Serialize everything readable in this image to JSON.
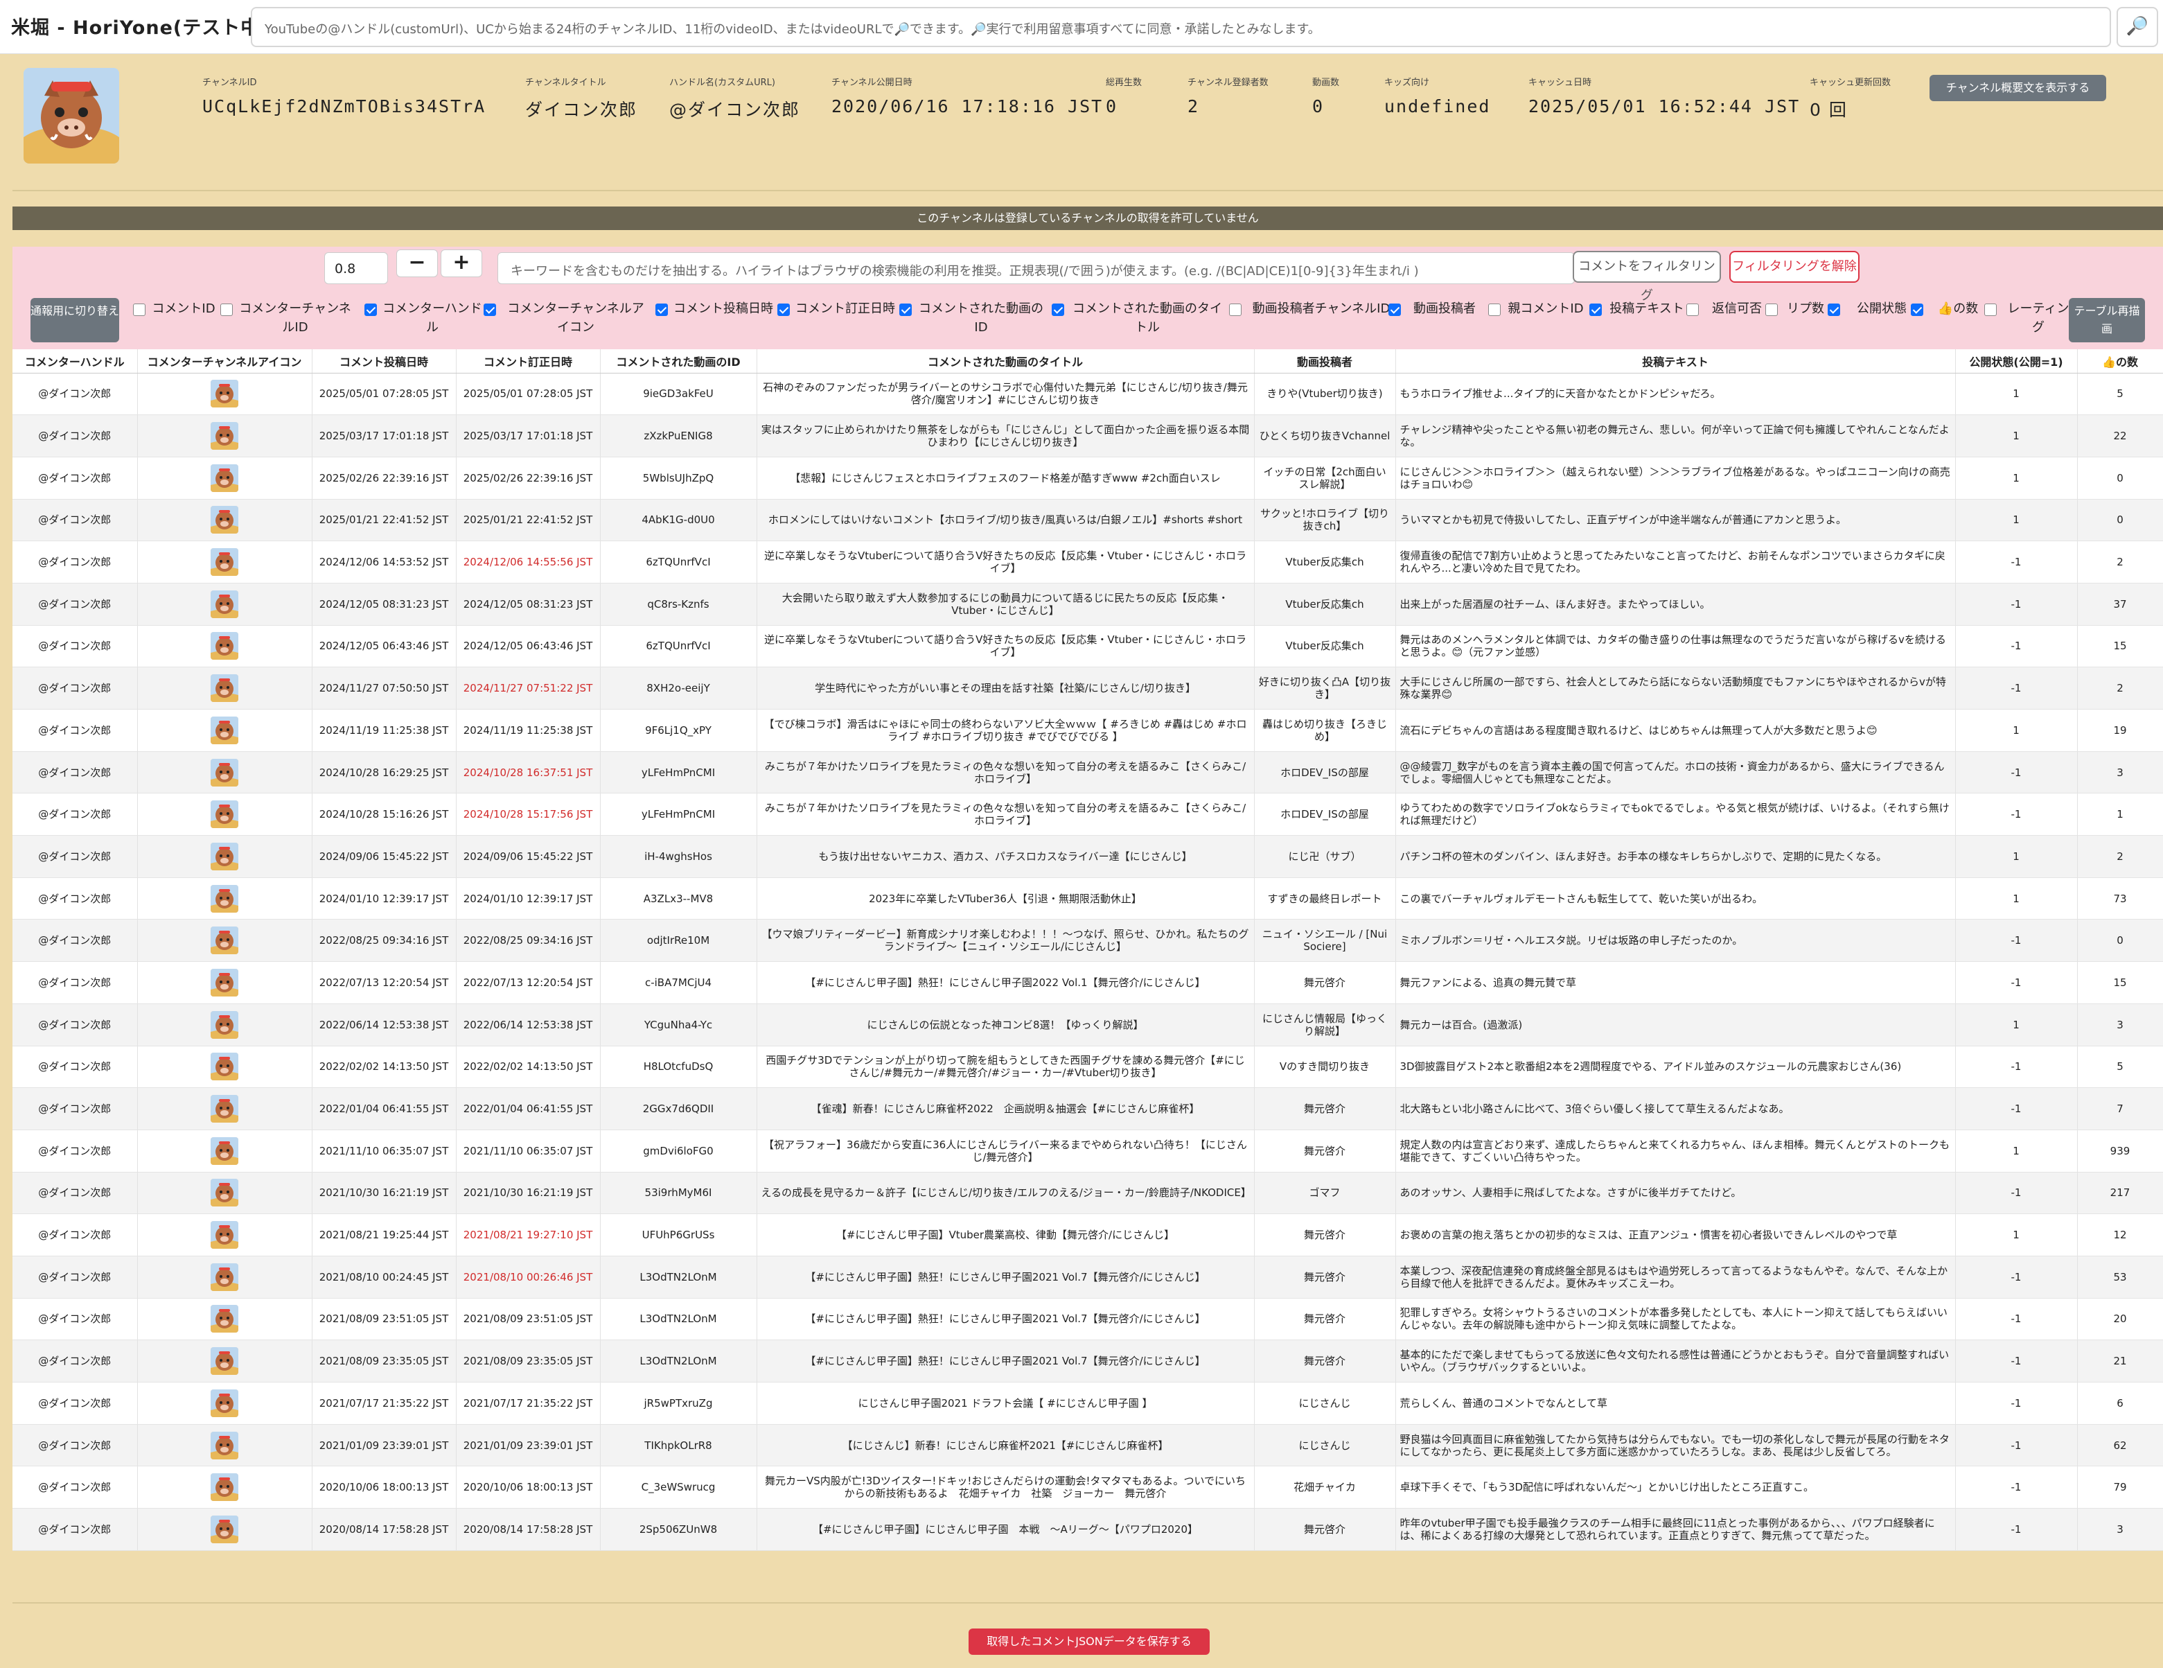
{
  "app": {
    "title": "米堀 - HoriYone(テスト中)",
    "search_placeholder": "YouTubeの@ハンドル(customUrl)、UCから始まる24桁のチャンネルID、11桁のvideoID、またはvideoURLで🔎できます。🔎実行で利用留意事項すべてに同意・承諾したとみなします。",
    "search_button_icon": "🔎"
  },
  "channel": {
    "fields": [
      {
        "label": "チャンネルID",
        "value": "UCqLkEjf2dNZmTOBis34STrA"
      },
      {
        "label": "チャンネルタイトル",
        "value": "ダイコン次郎"
      },
      {
        "label": "ハンドル名(カスタムURL)",
        "value": "@ダイコン次郎"
      },
      {
        "label": "チャンネル公開日時",
        "value": "2020/06/16 17:18:16 JST"
      },
      {
        "label": "総再生数",
        "value": "0"
      },
      {
        "label": "チャンネル登録者数",
        "value": "2"
      },
      {
        "label": "動画数",
        "value": "0"
      },
      {
        "label": "キッズ向け",
        "value": "undefined"
      },
      {
        "label": "キャッシュ日時",
        "value": "2025/05/01 16:52:44 JST"
      },
      {
        "label": "キャッシュ更新回数",
        "value": "0 回"
      }
    ],
    "show_description_button": "チャンネル概要文を表示する"
  },
  "notice": "このチャンネルは登録しているチャンネルの取得を許可していません",
  "filter": {
    "threshold_value": "0.8",
    "minus_label": "−",
    "plus_label": "+",
    "keyword_placeholder": "キーワードを含むものだけを抽出する。ハイライトはブラウザの検索機能の利用を推奨。正規表現(/で囲う)が使えます。(e.g. /(BC|AD|CE)1[0-9]{3}年生まれ/i )",
    "filter_button": "コメントをフィルタリング",
    "clear_button": "フィルタリングを解除",
    "mode_button": "通報用に切り替え",
    "redraw_button": "テーブル再描画",
    "columns": [
      {
        "label": "コメントID",
        "checked": false
      },
      {
        "label": "コメンターチャンネルID",
        "checked": false
      },
      {
        "label": "コメンターハンドル",
        "checked": true
      },
      {
        "label": "コメンターチャンネルアイコン",
        "checked": true
      },
      {
        "label": "コメント投稿日時",
        "checked": true
      },
      {
        "label": "コメント訂正日時",
        "checked": true
      },
      {
        "label": "コメントされた動画のID",
        "checked": true
      },
      {
        "label": "コメントされた動画のタイトル",
        "checked": true
      },
      {
        "label": "動画投稿者チャンネルID",
        "checked": false
      },
      {
        "label": "動画投稿者",
        "checked": true
      },
      {
        "label": "親コメントID",
        "checked": false
      },
      {
        "label": "投稿テキスト",
        "checked": true
      },
      {
        "label": "返信可否",
        "checked": false
      },
      {
        "label": "リプ数",
        "checked": false
      },
      {
        "label": "公開状態",
        "checked": true
      },
      {
        "label": "👍の数",
        "checked": true
      },
      {
        "label": "レーティング",
        "checked": false
      }
    ]
  },
  "table": {
    "headers": [
      "コメンターハンドル",
      "コメンターチャンネルアイコン",
      "コメント投稿日時",
      "コメント訂正日時",
      "コメントされた動画のID",
      "コメントされた動画のタイトル",
      "動画投稿者",
      "投稿テキスト",
      "公開状態(公開=1)",
      "👍の数"
    ],
    "rows": [
      {
        "handle": "@ダイコン次郎",
        "posted": "2025/05/01 07:28:05 JST",
        "edited": "2025/05/01 07:28:05 JST",
        "edited_red": false,
        "video_id": "9ieGD3akFeU",
        "video_title": "石神のぞみのファンだったが男ライバーとのサシコラボで心傷付いた舞元弟【にじさんじ/切り抜き/舞元啓介/魔宮リオン】#にじさんじ切り抜き",
        "uploader": "きりや(Vtuber切り抜き)",
        "text": "もうホロライブ推せよ...タイプ的に天音かなたとかドンピシャだろ。",
        "public": "1",
        "likes": "5"
      },
      {
        "handle": "@ダイコン次郎",
        "posted": "2025/03/17 17:01:18 JST",
        "edited": "2025/03/17 17:01:18 JST",
        "edited_red": false,
        "video_id": "zXzkPuENIG8",
        "video_title": "実はスタッフに止められかけたり無茶をしながらも「にじさんじ」として面白かった企画を振り返る本間ひまわり【にじさんじ切り抜き】",
        "uploader": "ひとくち切り抜きVchannel",
        "text": "チャレンジ精神や尖ったことやる無い初老の舞元さん、悲しい。何が辛いって正論で何も擁護してやれんことなんだよな。",
        "public": "1",
        "likes": "22"
      },
      {
        "handle": "@ダイコン次郎",
        "posted": "2025/02/26 22:39:16 JST",
        "edited": "2025/02/26 22:39:16 JST",
        "edited_red": false,
        "video_id": "5WblsUJhZpQ",
        "video_title": "【悲報】にじさんじフェスとホロライブフェスのフード格差が酷すぎwww #2ch面白いスレ",
        "uploader": "イッチの日常【2ch面白いスレ解説】",
        "text": "にじさんじ＞＞＞ホロライブ＞＞（越えられない壁）＞＞＞ラブライブ位格差があるな。やっぱユニコーン向けの商売はチョロいわ😊",
        "public": "1",
        "likes": "0"
      },
      {
        "handle": "@ダイコン次郎",
        "posted": "2025/01/21 22:41:52 JST",
        "edited": "2025/01/21 22:41:52 JST",
        "edited_red": false,
        "video_id": "4AbK1G-d0U0",
        "video_title": "ホロメンにしてはいけないコメント【ホロライブ/切り抜き/風真いろは/白銀ノエル】#shorts #short",
        "uploader": "サクッと!ホロライブ【切り抜きch】",
        "text": "ういママとかも初見で侍扱いしてたし、正直デザインが中途半端なんが普通にアカンと思うよ。",
        "public": "1",
        "likes": "0"
      },
      {
        "handle": "@ダイコン次郎",
        "posted": "2024/12/06 14:53:52 JST",
        "edited": "2024/12/06 14:55:56 JST",
        "edited_red": true,
        "video_id": "6zTQUnrfVcI",
        "video_title": "逆に卒業しなそうなVtuberについて語り合うV好きたちの反応【反応集・Vtuber・にじさんじ・ホロライブ】",
        "uploader": "Vtuber反応集ch",
        "text": "復帰直後の配信で7割方い止めようと思ってたみたいなこと言ってたけど、お前そんなポンコツでいまさらカタギに戻れんやろ...と凄い冷めた目で見てたわ。",
        "public": "-1",
        "likes": "2"
      },
      {
        "handle": "@ダイコン次郎",
        "posted": "2024/12/05 08:31:23 JST",
        "edited": "2024/12/05 08:31:23 JST",
        "edited_red": false,
        "video_id": "qC8rs-Kznfs",
        "video_title": "大会開いたら取り敢えず大人数参加するにじの動員力について語るじに民たちの反応【反応集・Vtuber・にじさんじ】",
        "uploader": "Vtuber反応集ch",
        "text": "出来上がった居酒屋の社チーム、ほんま好き。またやってほしい。",
        "public": "-1",
        "likes": "37"
      },
      {
        "handle": "@ダイコン次郎",
        "posted": "2024/12/05 06:43:46 JST",
        "edited": "2024/12/05 06:43:46 JST",
        "edited_red": false,
        "video_id": "6zTQUnrfVcI",
        "video_title": "逆に卒業しなそうなVtuberについて語り合うV好きたちの反応【反応集・Vtuber・にじさんじ・ホロライブ】",
        "uploader": "Vtuber反応集ch",
        "text": "舞元はあのメンヘラメンタルと体調では、カタギの働き盛りの仕事は無理なのでうだうだ言いながら稼げるvを続けると思うよ。😊（元ファン並感）",
        "public": "-1",
        "likes": "15"
      },
      {
        "handle": "@ダイコン次郎",
        "posted": "2024/11/27 07:50:50 JST",
        "edited": "2024/11/27 07:51:22 JST",
        "edited_red": true,
        "video_id": "8XH2o-eeijY",
        "video_title": "学生時代にやった方がいい事とその理由を話す社築【社築/にじさんじ/切り抜き】",
        "uploader": "好きに切り抜く凸A【切り抜き】",
        "text": "大手にじさんじ所属の一部ですら、社会人としてみたら話にならない活動頻度でもファンにちやほやされるからvが特殊な業界😊",
        "public": "-1",
        "likes": "2"
      },
      {
        "handle": "@ダイコン次郎",
        "posted": "2024/11/19 11:25:38 JST",
        "edited": "2024/11/19 11:25:38 JST",
        "edited_red": false,
        "video_id": "9F6Lj1Q_xPY",
        "video_title": "【でび棟コラボ】滑舌はにゃほにゃ同士の終わらないアソビ大全ｗｗｗ【 #ろきじめ #轟はじめ #ホロライブ #ホロライブ切り抜き #でびでびでびる 】",
        "uploader": "轟はじめ切り抜き【ろきじめ】",
        "text": "流石にデビちゃんの言語はある程度聞き取れるけど、はじめちゃんは無理って人が大多数だと思うよ😊",
        "public": "1",
        "likes": "19"
      },
      {
        "handle": "@ダイコン次郎",
        "posted": "2024/10/28 16:29:25 JST",
        "edited": "2024/10/28 16:37:51 JST",
        "edited_red": true,
        "video_id": "yLFeHmPnCMI",
        "video_title": "みこちが７年かけたソロライブを見たラミィの色々な想いを知って自分の考えを語るみこ【さくらみこ/ホロライブ】",
        "uploader": "ホロDEV_ISの部屋",
        "text": "@@綾雲刀_数字がものを言う資本主義の国で何言ってんだ。ホロの技術・資金力があるから、盛大にライブできるんでしょ。零細個人じゃとても無理なことだよ。",
        "public": "-1",
        "likes": "3"
      },
      {
        "handle": "@ダイコン次郎",
        "posted": "2024/10/28 15:16:26 JST",
        "edited": "2024/10/28 15:17:56 JST",
        "edited_red": true,
        "video_id": "yLFeHmPnCMI",
        "video_title": "みこちが７年かけたソロライブを見たラミィの色々な想いを知って自分の考えを語るみこ【さくらみこ/ホロライブ】",
        "uploader": "ホロDEV_ISの部屋",
        "text": "ゆうてわための数字でソロライブokならラミィでもokでるでしょ。やる気と根気が続けば、いけるよ。（それすら無ければ無理だけど）",
        "public": "-1",
        "likes": "1"
      },
      {
        "handle": "@ダイコン次郎",
        "posted": "2024/09/06 15:45:22 JST",
        "edited": "2024/09/06 15:45:22 JST",
        "edited_red": false,
        "video_id": "iH-4wghsHos",
        "video_title": "もう抜け出せないヤニカス、酒カス、パチスロカスなライバー達【にじさんじ】",
        "uploader": "にじ卍（サブ）",
        "text": "パチンコ杯の笹木のダンバイン、ほんま好き。お手本の様なキレちらかしぶりで、定期的に見たくなる。",
        "public": "1",
        "likes": "2"
      },
      {
        "handle": "@ダイコン次郎",
        "posted": "2024/01/10 12:39:17 JST",
        "edited": "2024/01/10 12:39:17 JST",
        "edited_red": false,
        "video_id": "A3ZLx3--MV8",
        "video_title": "2023年に卒業したVTuber36人【引退・無期限活動休止】",
        "uploader": "すずきの最終日レポート",
        "text": "この裏でバーチャルヴォルデモートさんも転生してて、乾いた笑いが出るわ。",
        "public": "1",
        "likes": "73"
      },
      {
        "handle": "@ダイコン次郎",
        "posted": "2022/08/25 09:34:16 JST",
        "edited": "2022/08/25 09:34:16 JST",
        "edited_red": false,
        "video_id": "odjtIrRe10M",
        "video_title": "【ウマ娘プリティーダービー】新育成シナリオ楽しむわよ！！！〜つなげ、照らせ、ひかれ。私たちのグランドライブ〜【ニュイ・ソシエール/にじさんじ】",
        "uploader": "ニュイ・ソシエール / [Nui Sociere]",
        "text": "ミホノブルボン＝リゼ・ヘルエスタ説。リゼは坂路の申し子だったのか。",
        "public": "-1",
        "likes": "0"
      },
      {
        "handle": "@ダイコン次郎",
        "posted": "2022/07/13 12:20:54 JST",
        "edited": "2022/07/13 12:20:54 JST",
        "edited_red": false,
        "video_id": "c-iBA7MCjU4",
        "video_title": "【#にじさんじ甲子園】熱狂！にじさんじ甲子園2022 Vol.1【舞元啓介/にじさんじ】",
        "uploader": "舞元啓介",
        "text": "舞元ファンによる、追真の舞元賛で草",
        "public": "-1",
        "likes": "15"
      },
      {
        "handle": "@ダイコン次郎",
        "posted": "2022/06/14 12:53:38 JST",
        "edited": "2022/06/14 12:53:38 JST",
        "edited_red": false,
        "video_id": "YCguNha4-Yc",
        "video_title": "にじさんじの伝説となった神コンビ8選！【ゆっくり解説】",
        "uploader": "にじさんじ情報局【ゆっくり解説】",
        "text": "舞元カーは百合。(過激派)",
        "public": "1",
        "likes": "3"
      },
      {
        "handle": "@ダイコン次郎",
        "posted": "2022/02/02 14:13:50 JST",
        "edited": "2022/02/02 14:13:50 JST",
        "edited_red": false,
        "video_id": "H8LOtcfuDsQ",
        "video_title": "西園チグサ3Dでテンションが上がり切って腕を組もうとしてきた西園チグサを諌める舞元啓介【#にじさんじ/#舞元カー/#舞元啓介/#ジョー・カー/#Vtuber切り抜き】",
        "uploader": "Vのすき間切り抜き",
        "text": "3D御披露目ゲスト2本と歌番組2本を2週間程度でやる、アイドル並みのスケジュールの元農家おじさん(36)",
        "public": "-1",
        "likes": "5"
      },
      {
        "handle": "@ダイコン次郎",
        "posted": "2022/01/04 06:41:55 JST",
        "edited": "2022/01/04 06:41:55 JST",
        "edited_red": false,
        "video_id": "2GGx7d6QDII",
        "video_title": "【雀魂】新春！にじさんじ麻雀杯2022　企画説明＆抽選会【#にじさんじ麻雀杯】",
        "uploader": "舞元啓介",
        "text": "北大路もとい北小路さんに比べて、3倍ぐらい優しく接してて草生えるんだよなあ。",
        "public": "-1",
        "likes": "7"
      },
      {
        "handle": "@ダイコン次郎",
        "posted": "2021/11/10 06:35:07 JST",
        "edited": "2021/11/10 06:35:07 JST",
        "edited_red": false,
        "video_id": "gmDvi6loFG0",
        "video_title": "【祝アラフォー】36歳だから安直に36人にじさんじライバー来るまでやめられない凸待ち！【にじさんじ/舞元啓介】",
        "uploader": "舞元啓介",
        "text": "規定人数の内は宣言どおり来ず、達成したらちゃんと来てくれる力ちゃん、ほんま相棒。舞元くんとゲストのトークも堪能できて、すごくいい凸待ちやった。",
        "public": "1",
        "likes": "939"
      },
      {
        "handle": "@ダイコン次郎",
        "posted": "2021/10/30 16:21:19 JST",
        "edited": "2021/10/30 16:21:19 JST",
        "edited_red": false,
        "video_id": "53i9rhMyM6I",
        "video_title": "えるの成長を見守るカー＆許子【にじさんじ/切り抜き/エルフのえる/ジョー・カー/鈴鹿詩子/NKODICE】",
        "uploader": "ゴマフ",
        "text": "あのオッサン、人妻相手に飛ばしてたよな。さすがに後半ガチてたけど。",
        "public": "-1",
        "likes": "217"
      },
      {
        "handle": "@ダイコン次郎",
        "posted": "2021/08/21 19:25:44 JST",
        "edited": "2021/08/21 19:27:10 JST",
        "edited_red": true,
        "video_id": "UFUhP6GrUSs",
        "video_title": "【#にじさんじ甲子園】Vtuber農業高校、律動【舞元啓介/にじさんじ】",
        "uploader": "舞元啓介",
        "text": "お褒めの言葉の抱え落ちとかの初歩的なミスは、正直アンジュ・慣害を初心者扱いできんレベルのやつで草",
        "public": "1",
        "likes": "12"
      },
      {
        "handle": "@ダイコン次郎",
        "posted": "2021/08/10 00:24:45 JST",
        "edited": "2021/08/10 00:26:46 JST",
        "edited_red": true,
        "video_id": "L3OdTN2LOnM",
        "video_title": "【#にじさんじ甲子園】熱狂！にじさんじ甲子園2021 Vol.7【舞元啓介/にじさんじ】",
        "uploader": "舞元啓介",
        "text": "本業しつつ、深夜配信連発の育成終盤全部見るはもはや過労死しろって言ってるようなもんやぞ。なんで、そんな上から目線で他人を批評できるんだよ。夏休みキッズこえーわ。",
        "public": "-1",
        "likes": "53"
      },
      {
        "handle": "@ダイコン次郎",
        "posted": "2021/08/09 23:51:05 JST",
        "edited": "2021/08/09 23:51:05 JST",
        "edited_red": false,
        "video_id": "L3OdTN2LOnM",
        "video_title": "【#にじさんじ甲子園】熱狂！にじさんじ甲子園2021 Vol.7【舞元啓介/にじさんじ】",
        "uploader": "舞元啓介",
        "text": "犯罪しすぎやろ。女将シャウトうるさいのコメントが本番多発したとしても、本人にトーン抑えて話してもらえばいいんじゃない。去年の解説陣も途中からトーン抑え気味に調整してたよな。",
        "public": "-1",
        "likes": "20"
      },
      {
        "handle": "@ダイコン次郎",
        "posted": "2021/08/09 23:35:05 JST",
        "edited": "2021/08/09 23:35:05 JST",
        "edited_red": false,
        "video_id": "L3OdTN2LOnM",
        "video_title": "【#にじさんじ甲子園】熱狂！にじさんじ甲子園2021 Vol.7【舞元啓介/にじさんじ】",
        "uploader": "舞元啓介",
        "text": "基本的にただで楽しませてもらってる放送に色々文句たれる感性は普通にどうかとおもうぞ。自分で音量調整すればいいやん。（ブラウザバックするといいよ。",
        "public": "-1",
        "likes": "21"
      },
      {
        "handle": "@ダイコン次郎",
        "posted": "2021/07/17 21:35:22 JST",
        "edited": "2021/07/17 21:35:22 JST",
        "edited_red": false,
        "video_id": "jR5wPTxruZg",
        "video_title": "にじさんじ甲子園2021 ドラフト会議【 #にじさんじ甲子園 】",
        "uploader": "にじさんじ",
        "text": "荒らしくん、普通のコメントでなんとして草",
        "public": "-1",
        "likes": "6"
      },
      {
        "handle": "@ダイコン次郎",
        "posted": "2021/01/09 23:39:01 JST",
        "edited": "2021/01/09 23:39:01 JST",
        "edited_red": false,
        "video_id": "TIKhpkOLrR8",
        "video_title": "【にじさんじ】新春！にじさんじ麻雀杯2021【#にじさんじ麻雀杯】",
        "uploader": "にじさんじ",
        "text": "野良猫は今回真面目に麻雀勉強してたから気持ちは分らんでもない。でも一切の茶化しなしで舞元が長尾の行動をネタにしてなかったら、更に長尾炎上して多方面に迷惑かかっていたろうしな。まあ、長尾は少し反省してろ。",
        "public": "-1",
        "likes": "62"
      },
      {
        "handle": "@ダイコン次郎",
        "posted": "2020/10/06 18:00:13 JST",
        "edited": "2020/10/06 18:00:13 JST",
        "edited_red": false,
        "video_id": "C_3eWSwrucg",
        "video_title": "舞元カーVS内股が亡!3Dツイスター!ドキッ!おじさんだらけの運動会!タマタマもあるよ。ついでにいちからの新技術もあるよ　花畑チャイカ　社築　ジョーカー　舞元啓介",
        "uploader": "花畑チャイカ",
        "text": "卓球下手くそで、「もう3D配信に呼ばれないんだ〜」とかいじけ出したところ正直すこ。",
        "public": "-1",
        "likes": "79"
      },
      {
        "handle": "@ダイコン次郎",
        "posted": "2020/08/14 17:58:28 JST",
        "edited": "2020/08/14 17:58:28 JST",
        "edited_red": false,
        "video_id": "2Sp506ZUnW8",
        "video_title": "【#にじさんじ甲子園】にじさんじ甲子園　本戦　〜Aリーグ〜【パワプロ2020】",
        "uploader": "舞元啓介",
        "text": "昨年のvtuber甲子園でも投手最強クラスのチーム相手に最終回に11点とった事例があるから、、、パワプロ経験者には、稀によくある打線の大爆発として恐れられています。正直点とりすぎて、舞元焦ってて草だった。",
        "public": "-1",
        "likes": "3"
      }
    ]
  },
  "footer": {
    "save_button": "取得したコメントJSONデータを保存する"
  }
}
